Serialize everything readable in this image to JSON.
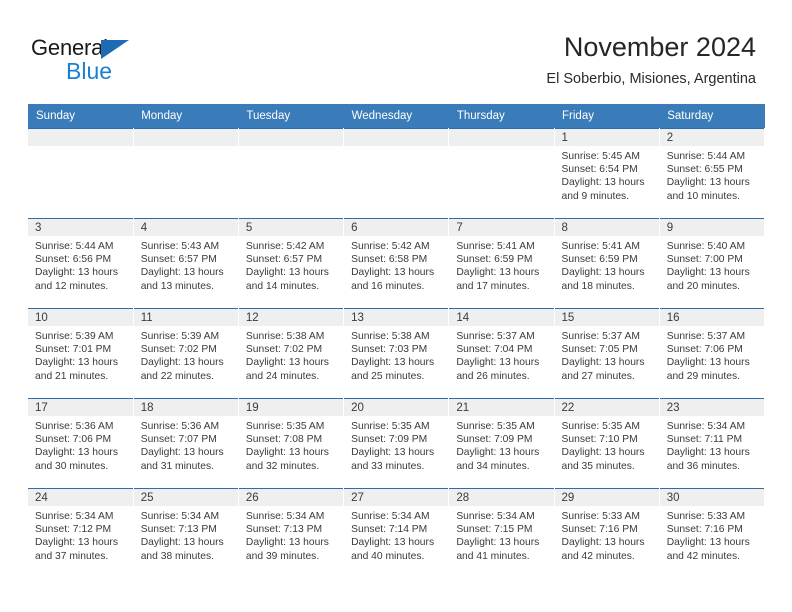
{
  "branding": {
    "logo_line1": "General",
    "logo_line2": "Blue",
    "logo_triangle_icon": "triangle-icon",
    "color_dark": "#1a1a1a",
    "color_blue": "#1b7fd4"
  },
  "header": {
    "title": "November 2024",
    "subtitle": "El Soberbio, Misiones, Argentina"
  },
  "theme": {
    "header_row_bg": "#3a7cb9",
    "row_top_border": "#2f6da8",
    "daynum_band_bg": "#efefef",
    "text": "#3b3b3b"
  },
  "calendar": {
    "weekday_headers": [
      "Sunday",
      "Monday",
      "Tuesday",
      "Wednesday",
      "Thursday",
      "Friday",
      "Saturday"
    ],
    "labels": {
      "sunrise": "Sunrise:",
      "sunset": "Sunset:",
      "daylight": "Daylight:"
    },
    "weeks": [
      [
        {
          "day": "",
          "empty": true
        },
        {
          "day": "",
          "empty": true
        },
        {
          "day": "",
          "empty": true
        },
        {
          "day": "",
          "empty": true
        },
        {
          "day": "",
          "empty": true
        },
        {
          "day": "1",
          "sunrise": "Sunrise: 5:45 AM",
          "sunset": "Sunset: 6:54 PM",
          "daylight_line1": "Daylight: 13 hours",
          "daylight_line2": "and 9 minutes."
        },
        {
          "day": "2",
          "sunrise": "Sunrise: 5:44 AM",
          "sunset": "Sunset: 6:55 PM",
          "daylight_line1": "Daylight: 13 hours",
          "daylight_line2": "and 10 minutes."
        }
      ],
      [
        {
          "day": "3",
          "sunrise": "Sunrise: 5:44 AM",
          "sunset": "Sunset: 6:56 PM",
          "daylight_line1": "Daylight: 13 hours",
          "daylight_line2": "and 12 minutes."
        },
        {
          "day": "4",
          "sunrise": "Sunrise: 5:43 AM",
          "sunset": "Sunset: 6:57 PM",
          "daylight_line1": "Daylight: 13 hours",
          "daylight_line2": "and 13 minutes."
        },
        {
          "day": "5",
          "sunrise": "Sunrise: 5:42 AM",
          "sunset": "Sunset: 6:57 PM",
          "daylight_line1": "Daylight: 13 hours",
          "daylight_line2": "and 14 minutes."
        },
        {
          "day": "6",
          "sunrise": "Sunrise: 5:42 AM",
          "sunset": "Sunset: 6:58 PM",
          "daylight_line1": "Daylight: 13 hours",
          "daylight_line2": "and 16 minutes."
        },
        {
          "day": "7",
          "sunrise": "Sunrise: 5:41 AM",
          "sunset": "Sunset: 6:59 PM",
          "daylight_line1": "Daylight: 13 hours",
          "daylight_line2": "and 17 minutes."
        },
        {
          "day": "8",
          "sunrise": "Sunrise: 5:41 AM",
          "sunset": "Sunset: 6:59 PM",
          "daylight_line1": "Daylight: 13 hours",
          "daylight_line2": "and 18 minutes."
        },
        {
          "day": "9",
          "sunrise": "Sunrise: 5:40 AM",
          "sunset": "Sunset: 7:00 PM",
          "daylight_line1": "Daylight: 13 hours",
          "daylight_line2": "and 20 minutes."
        }
      ],
      [
        {
          "day": "10",
          "sunrise": "Sunrise: 5:39 AM",
          "sunset": "Sunset: 7:01 PM",
          "daylight_line1": "Daylight: 13 hours",
          "daylight_line2": "and 21 minutes."
        },
        {
          "day": "11",
          "sunrise": "Sunrise: 5:39 AM",
          "sunset": "Sunset: 7:02 PM",
          "daylight_line1": "Daylight: 13 hours",
          "daylight_line2": "and 22 minutes."
        },
        {
          "day": "12",
          "sunrise": "Sunrise: 5:38 AM",
          "sunset": "Sunset: 7:02 PM",
          "daylight_line1": "Daylight: 13 hours",
          "daylight_line2": "and 24 minutes."
        },
        {
          "day": "13",
          "sunrise": "Sunrise: 5:38 AM",
          "sunset": "Sunset: 7:03 PM",
          "daylight_line1": "Daylight: 13 hours",
          "daylight_line2": "and 25 minutes."
        },
        {
          "day": "14",
          "sunrise": "Sunrise: 5:37 AM",
          "sunset": "Sunset: 7:04 PM",
          "daylight_line1": "Daylight: 13 hours",
          "daylight_line2": "and 26 minutes."
        },
        {
          "day": "15",
          "sunrise": "Sunrise: 5:37 AM",
          "sunset": "Sunset: 7:05 PM",
          "daylight_line1": "Daylight: 13 hours",
          "daylight_line2": "and 27 minutes."
        },
        {
          "day": "16",
          "sunrise": "Sunrise: 5:37 AM",
          "sunset": "Sunset: 7:06 PM",
          "daylight_line1": "Daylight: 13 hours",
          "daylight_line2": "and 29 minutes."
        }
      ],
      [
        {
          "day": "17",
          "sunrise": "Sunrise: 5:36 AM",
          "sunset": "Sunset: 7:06 PM",
          "daylight_line1": "Daylight: 13 hours",
          "daylight_line2": "and 30 minutes."
        },
        {
          "day": "18",
          "sunrise": "Sunrise: 5:36 AM",
          "sunset": "Sunset: 7:07 PM",
          "daylight_line1": "Daylight: 13 hours",
          "daylight_line2": "and 31 minutes."
        },
        {
          "day": "19",
          "sunrise": "Sunrise: 5:35 AM",
          "sunset": "Sunset: 7:08 PM",
          "daylight_line1": "Daylight: 13 hours",
          "daylight_line2": "and 32 minutes."
        },
        {
          "day": "20",
          "sunrise": "Sunrise: 5:35 AM",
          "sunset": "Sunset: 7:09 PM",
          "daylight_line1": "Daylight: 13 hours",
          "daylight_line2": "and 33 minutes."
        },
        {
          "day": "21",
          "sunrise": "Sunrise: 5:35 AM",
          "sunset": "Sunset: 7:09 PM",
          "daylight_line1": "Daylight: 13 hours",
          "daylight_line2": "and 34 minutes."
        },
        {
          "day": "22",
          "sunrise": "Sunrise: 5:35 AM",
          "sunset": "Sunset: 7:10 PM",
          "daylight_line1": "Daylight: 13 hours",
          "daylight_line2": "and 35 minutes."
        },
        {
          "day": "23",
          "sunrise": "Sunrise: 5:34 AM",
          "sunset": "Sunset: 7:11 PM",
          "daylight_line1": "Daylight: 13 hours",
          "daylight_line2": "and 36 minutes."
        }
      ],
      [
        {
          "day": "24",
          "sunrise": "Sunrise: 5:34 AM",
          "sunset": "Sunset: 7:12 PM",
          "daylight_line1": "Daylight: 13 hours",
          "daylight_line2": "and 37 minutes."
        },
        {
          "day": "25",
          "sunrise": "Sunrise: 5:34 AM",
          "sunset": "Sunset: 7:13 PM",
          "daylight_line1": "Daylight: 13 hours",
          "daylight_line2": "and 38 minutes."
        },
        {
          "day": "26",
          "sunrise": "Sunrise: 5:34 AM",
          "sunset": "Sunset: 7:13 PM",
          "daylight_line1": "Daylight: 13 hours",
          "daylight_line2": "and 39 minutes."
        },
        {
          "day": "27",
          "sunrise": "Sunrise: 5:34 AM",
          "sunset": "Sunset: 7:14 PM",
          "daylight_line1": "Daylight: 13 hours",
          "daylight_line2": "and 40 minutes."
        },
        {
          "day": "28",
          "sunrise": "Sunrise: 5:34 AM",
          "sunset": "Sunset: 7:15 PM",
          "daylight_line1": "Daylight: 13 hours",
          "daylight_line2": "and 41 minutes."
        },
        {
          "day": "29",
          "sunrise": "Sunrise: 5:33 AM",
          "sunset": "Sunset: 7:16 PM",
          "daylight_line1": "Daylight: 13 hours",
          "daylight_line2": "and 42 minutes."
        },
        {
          "day": "30",
          "sunrise": "Sunrise: 5:33 AM",
          "sunset": "Sunset: 7:16 PM",
          "daylight_line1": "Daylight: 13 hours",
          "daylight_line2": "and 42 minutes."
        }
      ]
    ]
  }
}
